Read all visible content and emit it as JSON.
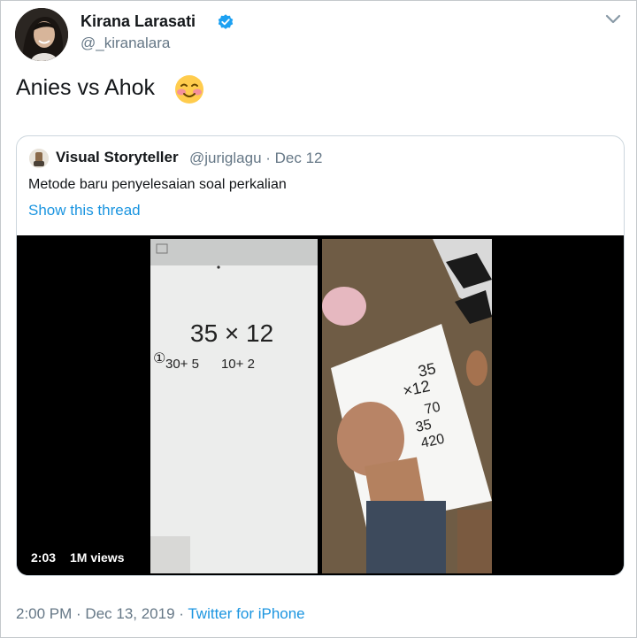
{
  "tweet": {
    "author_name": "Kirana Larasati",
    "author_handle": "@_kiranalara",
    "text": "Anies vs Ahok",
    "emoji": "smiling-face-with-blush",
    "timestamp": "2:00 PM · Dec 13, 2019 · ",
    "source": "Twitter for iPhone"
  },
  "quoted": {
    "author_name": "Visual Storyteller",
    "author_handle": "@juriglagu · Dec 12",
    "text": "Metode baru penyelesaian soal perkalian",
    "thread_link": "Show this thread",
    "video": {
      "duration": "2:03",
      "views": "1M views",
      "whiteboard_line1": "35 × 12",
      "whiteboard_mark": "①",
      "whiteboard_line2": "30+ 5      10+ 2",
      "paper_lines": [
        "35",
        "×12",
        "70",
        "35",
        "420"
      ]
    }
  },
  "colors": {
    "link": "#1b95e0",
    "secondary_text": "#657786",
    "primary_text": "#14171a",
    "verified": "#1da1f2"
  },
  "icons": [
    "verified-badge-icon",
    "chevron-down-icon",
    "blush-emoji-icon"
  ]
}
